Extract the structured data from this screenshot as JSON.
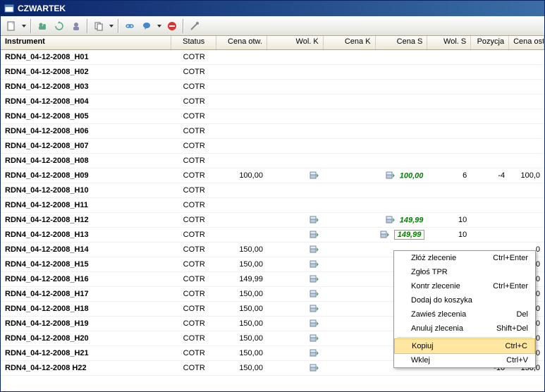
{
  "window": {
    "title": "CZWARTEK"
  },
  "columns": {
    "instrument": "Instrument",
    "status": "Status",
    "cenaotw": "Cena otw.",
    "wolk": "Wol. K",
    "cenak": "Cena K",
    "cenas": "Cena S",
    "wols": "Wol. S",
    "pozycja": "Pozycja",
    "cenaost": "Cena ost."
  },
  "rows": [
    {
      "instr": "RDN4_04-12-2008_H01",
      "status": "COTR"
    },
    {
      "instr": "RDN4_04-12-2008_H02",
      "status": "COTR"
    },
    {
      "instr": "RDN4_04-12-2008_H03",
      "status": "COTR"
    },
    {
      "instr": "RDN4_04-12-2008_H04",
      "status": "COTR"
    },
    {
      "instr": "RDN4_04-12-2008_H05",
      "status": "COTR"
    },
    {
      "instr": "RDN4_04-12-2008_H06",
      "status": "COTR"
    },
    {
      "instr": "RDN4_04-12-2008_H07",
      "status": "COTR"
    },
    {
      "instr": "RDN4_04-12-2008_H08",
      "status": "COTR"
    },
    {
      "instr": "RDN4_04-12-2008_H09",
      "status": "COTR",
      "cenaotw": "100,00",
      "iconK": true,
      "iconS": true,
      "cenas": "100,00",
      "wols": "6",
      "poz": "-4",
      "cenaost": "100,0"
    },
    {
      "instr": "RDN4_04-12-2008_H10",
      "status": "COTR"
    },
    {
      "instr": "RDN4_04-12-2008_H11",
      "status": "COTR"
    },
    {
      "instr": "RDN4_04-12-2008_H12",
      "status": "COTR",
      "iconK": true,
      "iconS": true,
      "cenas": "149,99",
      "wols": "10"
    },
    {
      "instr": "RDN4_04-12-2008_H13",
      "status": "COTR",
      "iconK": true,
      "iconS": true,
      "cenas": "149,99",
      "wols": "10",
      "selected": true
    },
    {
      "instr": "RDN4_04-12-2008_H14",
      "status": "COTR",
      "cenaotw": "150,00",
      "iconK": true,
      "cenaost": ",0"
    },
    {
      "instr": "RDN4_04-12-2008_H15",
      "status": "COTR",
      "cenaotw": "150,00",
      "iconK": true,
      "cenaost": ",0"
    },
    {
      "instr": "RDN4_04-12-2008_H16",
      "status": "COTR",
      "cenaotw": "149,99",
      "iconK": true,
      "cenaost": ",0"
    },
    {
      "instr": "RDN4_04-12-2008_H17",
      "status": "COTR",
      "cenaotw": "150,00",
      "iconK": true,
      "cenaost": ",0"
    },
    {
      "instr": "RDN4_04-12-2008_H18",
      "status": "COTR",
      "cenaotw": "150,00",
      "iconK": true,
      "cenaost": ",0"
    },
    {
      "instr": "RDN4_04-12-2008_H19",
      "status": "COTR",
      "cenaotw": "150,00",
      "iconK": true,
      "cenaost": ",0"
    },
    {
      "instr": "RDN4_04-12-2008_H20",
      "status": "COTR",
      "cenaotw": "150,00",
      "iconK": true,
      "cenaost": ",0"
    },
    {
      "instr": "RDN4_04-12-2008_H21",
      "status": "COTR",
      "cenaotw": "150,00",
      "iconK": true,
      "cenaost": ",0"
    },
    {
      "instr": "RDN4_04-12-2008 H22",
      "status": "COTR",
      "cenaotw": "150,00",
      "iconK": true,
      "poz": "-10",
      "cenaost": "150,0"
    }
  ],
  "context_menu": [
    {
      "label": "Złóż zlecenie",
      "shortcut": "Ctrl+Enter"
    },
    {
      "label": "Zgłoś TPR",
      "shortcut": ""
    },
    {
      "label": "Kontr zlecenie",
      "shortcut": "Ctrl+Enter"
    },
    {
      "label": "Dodaj do koszyka",
      "shortcut": ""
    },
    {
      "label": "Zawieś zlecenia",
      "shortcut": "Del"
    },
    {
      "label": "Anuluj zlecenia",
      "shortcut": "Shift+Del"
    },
    {
      "sep": true
    },
    {
      "label": "Kopiuj",
      "shortcut": "Ctrl+C",
      "hl": true
    },
    {
      "label": "Wklej",
      "shortcut": "Ctrl+V"
    }
  ]
}
